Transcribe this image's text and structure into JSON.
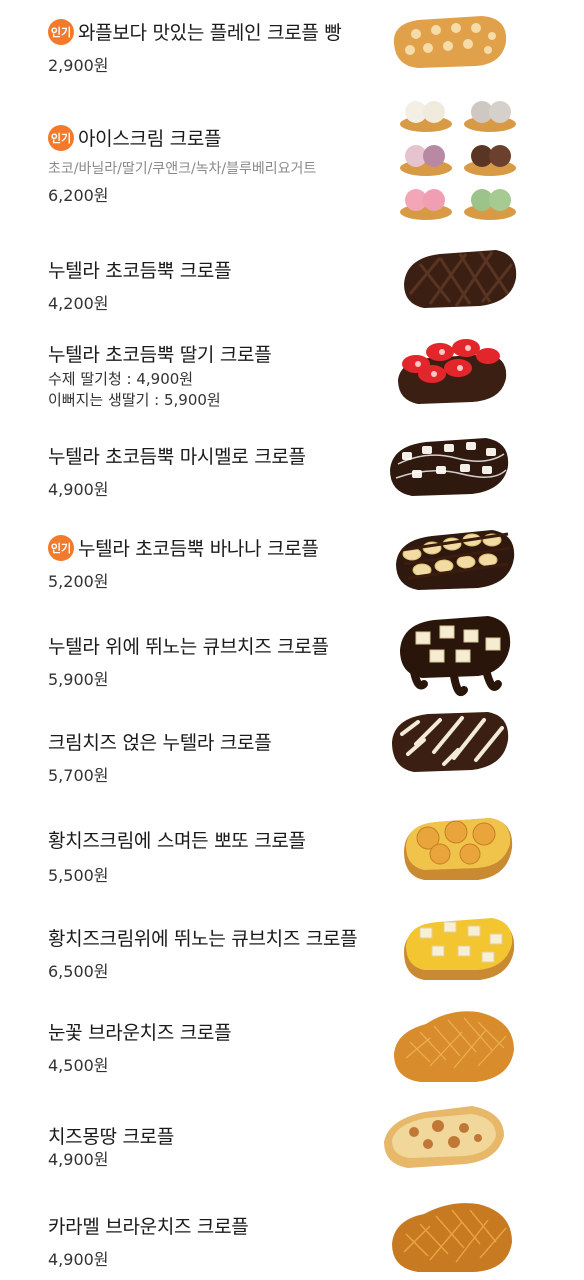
{
  "badge_label": "인기",
  "items": [
    {
      "name": "와플보다 맛있는 플레인 크로플 빵",
      "price": "2,900원",
      "popular": true,
      "image": "plain-croffle"
    },
    {
      "name": "아이스크림 크로플",
      "flavors": "초코/바닐라/딸기/쿠앤크/녹차/블루베리요거트",
      "price": "6,200원",
      "popular": true,
      "image": "icecream-croffle"
    },
    {
      "name": "누텔라 초코듬뿍 크로플",
      "price": "4,200원",
      "popular": false,
      "image": "nutella-croffle"
    },
    {
      "name": "누텔라 초코듬뿍 딸기 크로플",
      "option1": "수제 딸기청 : 4,900원",
      "option2": "이뻐지는 생딸기 : 5,900원",
      "popular": false,
      "image": "strawberry-croffle"
    },
    {
      "name": "누텔라 초코듬뿍 마시멜로 크로플",
      "price": "4,900원",
      "popular": false,
      "image": "marshmallow-croffle"
    },
    {
      "name": "누텔라 초코듬뿍 바나나 크로플",
      "price": "5,200원",
      "popular": true,
      "image": "banana-croffle"
    },
    {
      "name": "누텔라 위에 뛰노는 큐브치즈 크로플",
      "price": "5,900원",
      "popular": false,
      "image": "cubecheese-croffle"
    },
    {
      "name": "크림치즈 얹은 누텔라 크로플",
      "price": "5,700원",
      "popular": false,
      "image": "creamcheese-croffle"
    },
    {
      "name": "황치즈크림에 스며든 뽀또 크로플",
      "price": "5,500원",
      "popular": false,
      "image": "potto-croffle"
    },
    {
      "name": "황치즈크림위에 뛰노는 큐브치즈 크로플",
      "price": "6,500원",
      "popular": false,
      "image": "yellowcheese-cube-croffle"
    },
    {
      "name": "눈꽃 브라운치즈 크로플",
      "price": "4,500원",
      "popular": false,
      "image": "snow-browncheese-croffle"
    },
    {
      "name": "치즈몽땅 크로플",
      "price": "4,900원",
      "popular": false,
      "image": "cheese-croffle"
    },
    {
      "name": "카라멜 브라운치즈 크로플",
      "price": "4,900원",
      "popular": false,
      "image": "caramel-browncheese-croffle"
    }
  ],
  "colors": {
    "badge": "#f47a2b",
    "text": "#1a1a1a",
    "subtext": "#8a8a8a"
  }
}
